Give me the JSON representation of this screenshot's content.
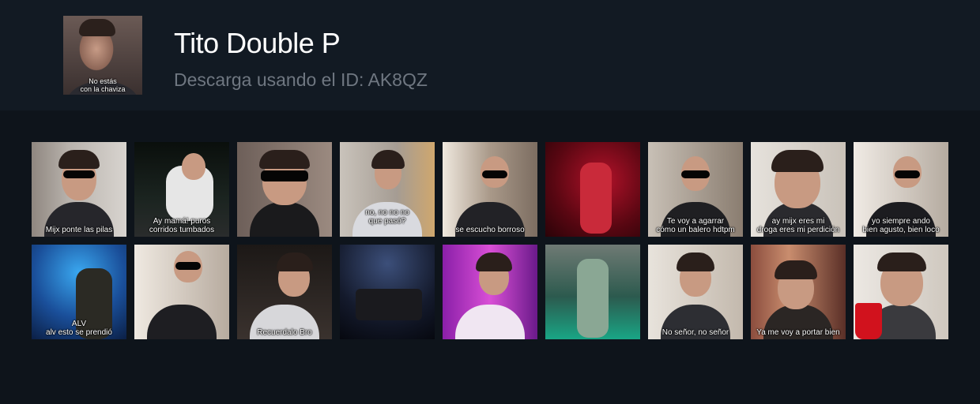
{
  "header": {
    "title": "Tito Double P",
    "subtitle": "Descarga usando el ID: AK8QZ",
    "avatar_caption": "No estás\ncon la chaviza"
  },
  "stickers": [
    {
      "caption": "Mijx ponte las pilas"
    },
    {
      "caption": "Ay mamá! puros\ncorridos tumbados"
    },
    {
      "caption": ""
    },
    {
      "caption": "no, no no no\nque pasó?"
    },
    {
      "caption": "se escucho borroso"
    },
    {
      "caption": ""
    },
    {
      "caption": "Te voy a agarrar\ncómo un balero hdtpm"
    },
    {
      "caption": "ay mijx eres mi\ndroga eres mi perdición"
    },
    {
      "caption": "yo siempre ando\nbien agusto, bien loco"
    },
    {
      "caption": "ALV\nalv esto se prendió"
    },
    {
      "caption": ""
    },
    {
      "caption": "Recuerdalo Bro"
    },
    {
      "caption": ""
    },
    {
      "caption": ""
    },
    {
      "caption": ""
    },
    {
      "caption": "No señor, no señor"
    },
    {
      "caption": "Ya me voy a portar bien"
    },
    {
      "caption": ""
    }
  ]
}
